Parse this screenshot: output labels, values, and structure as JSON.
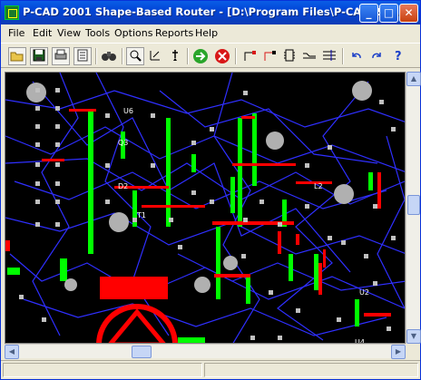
{
  "window": {
    "title": "P-CAD 2001 Shape-Based Router - [D:\\Program Files\\P-CAD 200...",
    "minimize_glyph": "_",
    "maximize_glyph": "□",
    "close_glyph": "✕"
  },
  "menu": {
    "items": [
      "File",
      "Edit",
      "View",
      "Tools",
      "Options",
      "Reports",
      "Help"
    ]
  },
  "toolbar": {
    "icons": [
      "open-folder-icon",
      "save-icon",
      "print-icon",
      "print-setup-icon",
      "binoculars-icon",
      "zoom-window-icon",
      "measure-icon",
      "pin-icon",
      "route-start-icon",
      "route-stop-icon",
      "route-net-icon",
      "route-connection-icon",
      "route-component-icon",
      "smooth-icon",
      "mitre-icon",
      "undo-icon",
      "redo-icon",
      "help-icon"
    ]
  },
  "board": {
    "component_labels": [
      "U6",
      "Q3",
      "D2",
      "T1",
      "L2",
      "U2",
      "U4"
    ],
    "colors": {
      "background": "#000000",
      "trace_blue": "#2f2fff",
      "trace_red": "#ff0000",
      "trace_green": "#00ff00",
      "pad_gray": "#c0c0c0"
    }
  }
}
